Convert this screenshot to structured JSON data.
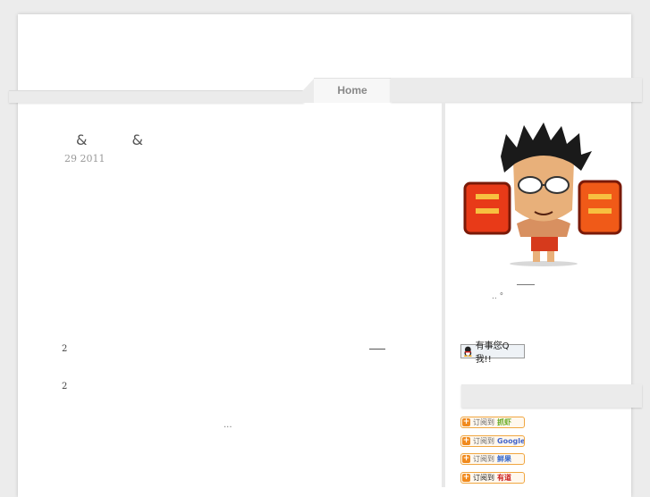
{
  "nav": {
    "home_label": "Home"
  },
  "post": {
    "title_parts": [
      "&",
      "&"
    ],
    "date": "29 2011",
    "lines": [
      "2",
      "2"
    ],
    "ellipsis": "..."
  },
  "sidebar": {
    "note": ".. °",
    "qq_badge": "有事您Q我!!",
    "subscribe_buttons": [
      {
        "prefix": "订阅到",
        "brand": "抓虾",
        "brand_color": "#66aa22"
      },
      {
        "prefix": "订阅到",
        "brand": "Google",
        "brand_color": "#4466cc"
      },
      {
        "prefix": "订阅到",
        "brand": "鲜果",
        "brand_color": "#3366cc"
      },
      {
        "prefix": "订阅到",
        "brand": "有道",
        "brand_color": "#cc2222"
      }
    ]
  },
  "colors": {
    "page": "#ffffff",
    "background": "#ececec",
    "bar": "#ebebeb",
    "subscribe_border": "#f0a640"
  }
}
